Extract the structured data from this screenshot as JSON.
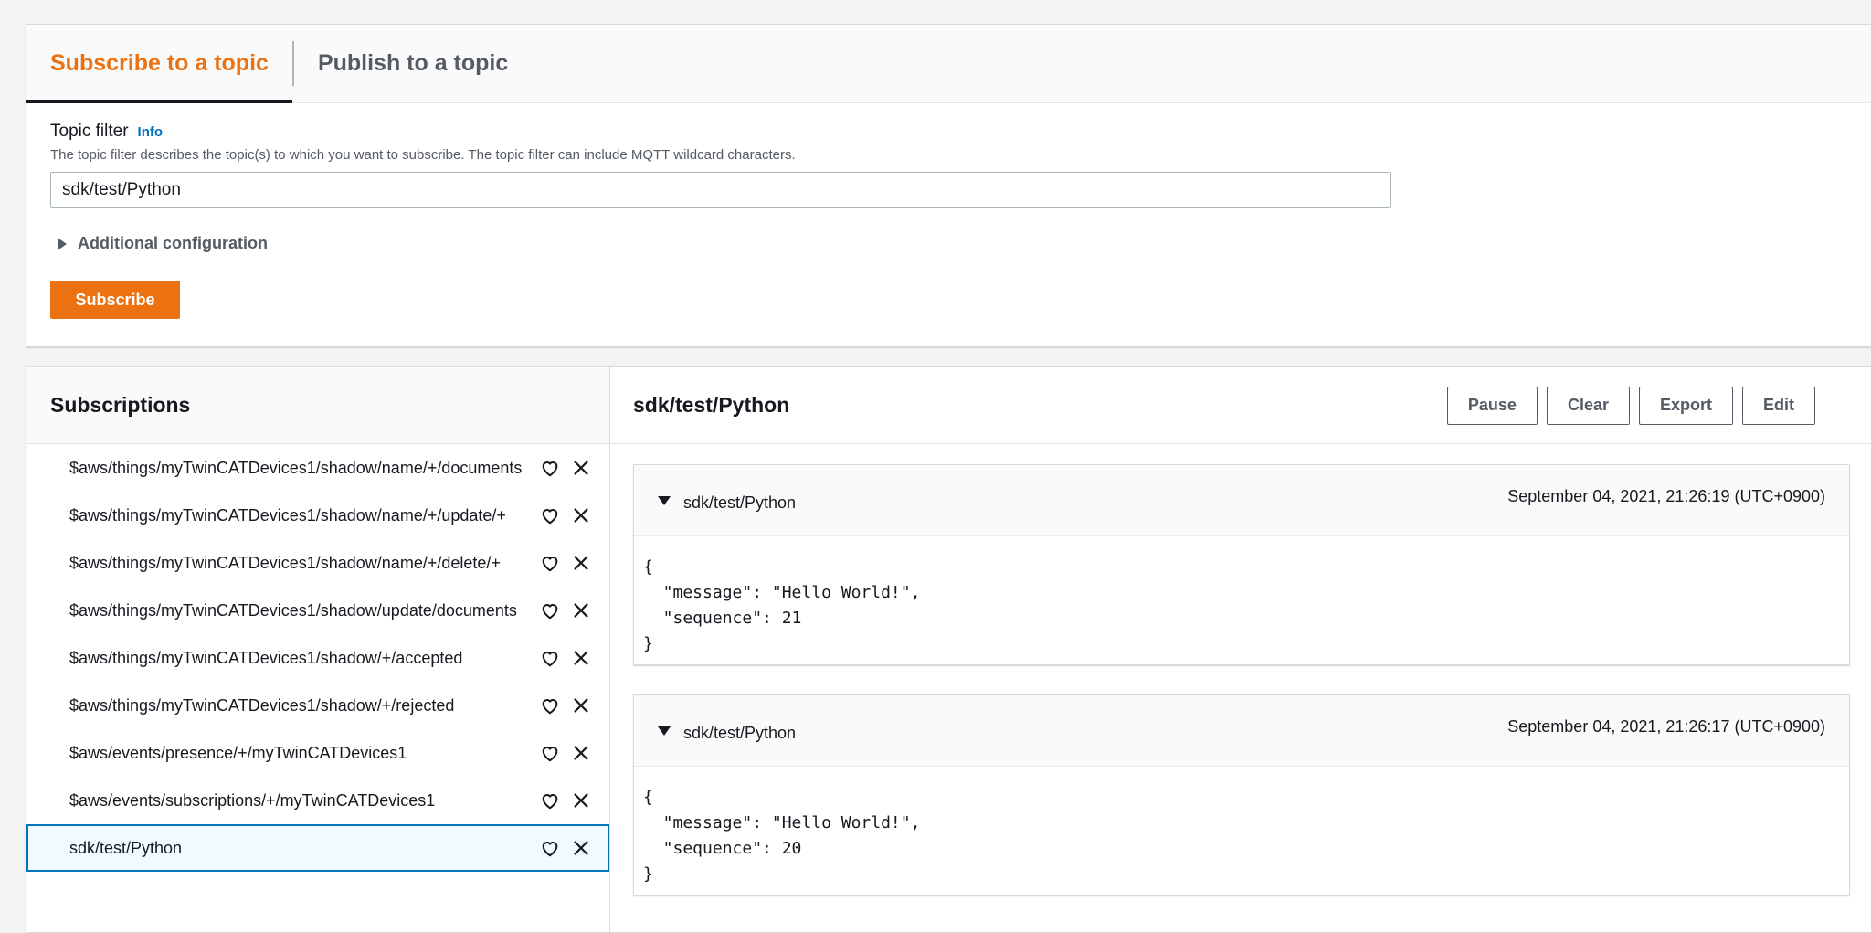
{
  "tabs": {
    "subscribe": "Subscribe to a topic",
    "publish": "Publish to a topic"
  },
  "form": {
    "label": "Topic filter",
    "info": "Info",
    "description": "The topic filter describes the topic(s) to which you want to subscribe. The topic filter can include MQTT wildcard characters.",
    "value": "sdk/test/Python",
    "additional": "Additional configuration",
    "subscribe_button": "Subscribe"
  },
  "subscriptions": {
    "title": "Subscriptions",
    "items": [
      "$aws/things/myTwinCATDevices1/shadow/name/+/documents",
      "$aws/things/myTwinCATDevices1/shadow/name/+/update/+",
      "$aws/things/myTwinCATDevices1/shadow/name/+/delete/+",
      "$aws/things/myTwinCATDevices1/shadow/update/documents",
      "$aws/things/myTwinCATDevices1/shadow/+/accepted",
      "$aws/things/myTwinCATDevices1/shadow/+/rejected",
      "$aws/events/presence/+/myTwinCATDevices1",
      "$aws/events/subscriptions/+/myTwinCATDevices1",
      "sdk/test/Python"
    ],
    "selected_index": 8
  },
  "messages_pane": {
    "title": "sdk/test/Python",
    "buttons": {
      "pause": "Pause",
      "clear": "Clear",
      "export": "Export",
      "edit": "Edit"
    },
    "messages": [
      {
        "topic": "sdk/test/Python",
        "time": "September 04, 2021, 21:26:19 (UTC+0900)",
        "body": "{\n  \"message\": \"Hello World!\",\n  \"sequence\": 21\n}"
      },
      {
        "topic": "sdk/test/Python",
        "time": "September 04, 2021, 21:26:17 (UTC+0900)",
        "body": "{\n  \"message\": \"Hello World!\",\n  \"sequence\": 20\n}"
      }
    ]
  },
  "colors": {
    "accent": "#ec7211",
    "link": "#0073bb",
    "selected_border": "#0073bb",
    "selected_bg": "#f1faff"
  }
}
